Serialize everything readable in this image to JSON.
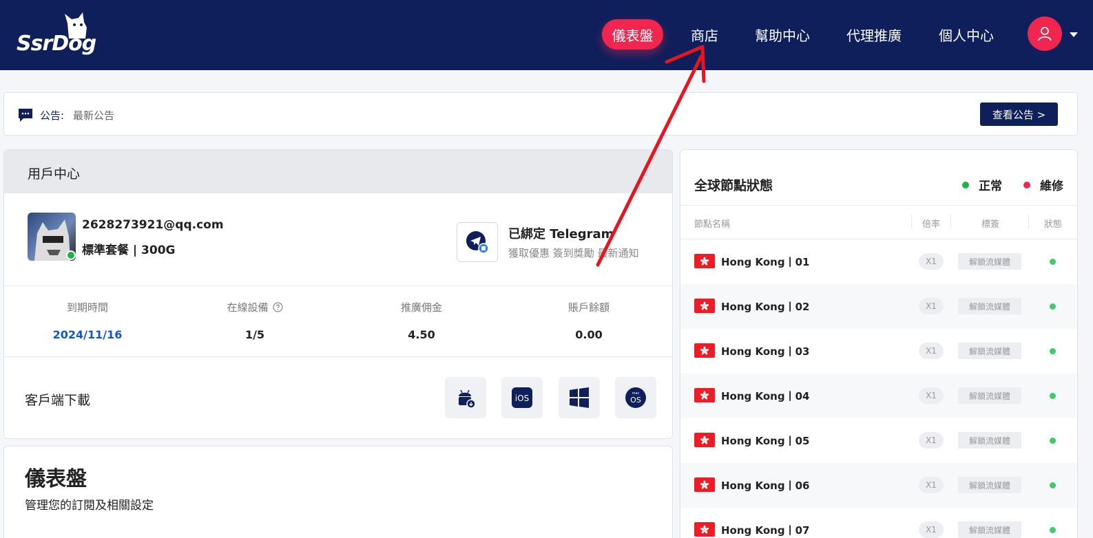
{
  "header": {
    "logo_text": "SsrDog",
    "nav": [
      {
        "label": "儀表盤",
        "active": true
      },
      {
        "label": "商店",
        "active": false
      },
      {
        "label": "幫助中心",
        "active": false
      },
      {
        "label": "代理推廣",
        "active": false
      },
      {
        "label": "個人中心",
        "active": false
      }
    ],
    "user_icon": "user-icon"
  },
  "announcement": {
    "label": "公告:",
    "text": "最新公告",
    "button_label": "查看公告 >"
  },
  "user_center": {
    "title": "用戶中心",
    "email": "2628273921@qq.com",
    "plan": "標準套餐 | 300G",
    "telegram": {
      "title": "已綁定 Telegram",
      "subtitle": "獲取優惠 簽到獎勵 最新通知"
    },
    "stats": [
      {
        "label": "到期時間",
        "value": "2024/11/16"
      },
      {
        "label": "在線設備",
        "value": "1/5"
      },
      {
        "label": "推廣佣金",
        "value": "4.50"
      },
      {
        "label": "賬戶餘額",
        "value": "0.00"
      }
    ],
    "download": {
      "title": "客戶端下載",
      "clients": [
        "android-icon",
        "ios-icon",
        "windows-icon",
        "macos-icon"
      ],
      "ios_label": "iOS",
      "mac_label_top": "mac",
      "mac_label_bottom": "OS"
    }
  },
  "dashboard": {
    "title": "儀表盤",
    "subtitle": "管理您的訂閱及相關設定"
  },
  "nodes": {
    "title": "全球節點狀態",
    "legend_normal": "正常",
    "legend_maintenance": "維修",
    "columns": [
      "節點名稱",
      "倍率",
      "標簽",
      "狀態"
    ],
    "rows": [
      {
        "name": "Hong Kong丨01",
        "rate": "X1",
        "tag": "解鎖流媒體"
      },
      {
        "name": "Hong Kong丨02",
        "rate": "X1",
        "tag": "解鎖流媒體"
      },
      {
        "name": "Hong Kong丨03",
        "rate": "X1",
        "tag": "解鎖流媒體"
      },
      {
        "name": "Hong Kong丨04",
        "rate": "X1",
        "tag": "解鎖流媒體"
      },
      {
        "name": "Hong Kong丨05",
        "rate": "X1",
        "tag": "解鎖流媒體"
      },
      {
        "name": "Hong Kong丨06",
        "rate": "X1",
        "tag": "解鎖流媒體"
      },
      {
        "name": "Hong Kong丨07",
        "rate": "X1",
        "tag": "解鎖流媒體"
      }
    ]
  },
  "colors": {
    "navy": "#0e1f5b",
    "accent": "#f0264f",
    "status_ok": "#3ecb6a",
    "expiry_blue": "#1357c7"
  }
}
